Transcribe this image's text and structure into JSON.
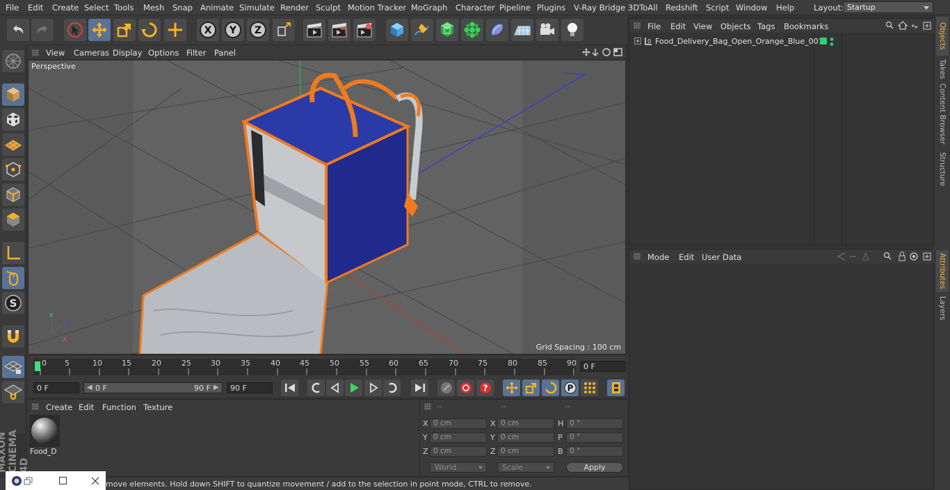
{
  "menubar": {
    "items": [
      "File",
      "Edit",
      "Create",
      "Select",
      "Tools",
      "Mesh",
      "Snap",
      "Animate",
      "Simulate",
      "Render",
      "Sculpt",
      "Motion Tracker",
      "MoGraph",
      "Character",
      "Pipeline",
      "Plugins",
      "V-Ray Bridge",
      "3DToAll",
      "Redshift",
      "Script",
      "Window",
      "Help"
    ],
    "layout_label": "Layout:",
    "layout_value": "Startup"
  },
  "viewport": {
    "menu": [
      "View",
      "Cameras",
      "Display",
      "Options",
      "Filter",
      "Panel"
    ],
    "label": "Perspective",
    "grid_spacing": "Grid Spacing : 100 cm"
  },
  "timeline": {
    "ticks": [
      "0",
      "5",
      "10",
      "15",
      "20",
      "25",
      "30",
      "35",
      "40",
      "45",
      "50",
      "55",
      "60",
      "65",
      "70",
      "75",
      "80",
      "85",
      "90"
    ],
    "current_frame": "0 F"
  },
  "playbar": {
    "start_field": "0 F",
    "range_start": "0 F",
    "range_end": "90 F",
    "end_field": "90 F"
  },
  "materials": {
    "menu": [
      "Create",
      "Edit",
      "Function",
      "Texture"
    ],
    "items": [
      {
        "label": "Food_D"
      }
    ]
  },
  "coordinates": {
    "headers": [
      "--",
      "--",
      "--"
    ],
    "rows": [
      {
        "l1": "X",
        "v1": "0 cm",
        "l2": "X",
        "v2": "0 cm",
        "l3": "H",
        "v3": "0 °"
      },
      {
        "l1": "Y",
        "v1": "0 cm",
        "l2": "Y",
        "v2": "0 cm",
        "l3": "P",
        "v3": "0 °"
      },
      {
        "l1": "Z",
        "v1": "0 cm",
        "l2": "Z",
        "v2": "0 cm",
        "l3": "B",
        "v3": "0 °"
      }
    ],
    "world": "World",
    "scale": "Scale",
    "apply": "Apply"
  },
  "objects": {
    "menu": [
      "File",
      "Edit",
      "View",
      "Objects",
      "Tags",
      "Bookmarks"
    ],
    "items": [
      {
        "name": "Food_Delivery_Bag_Open_Orange_Blue_001"
      }
    ]
  },
  "attributes": {
    "menu": [
      "Mode",
      "Edit",
      "User Data"
    ]
  },
  "right_tabs": {
    "top": [
      "Objects",
      "Takes",
      "Content Browser",
      "Structure"
    ],
    "bottom": [
      "Attributes",
      "Layers"
    ]
  },
  "brand": "MAXON CINEMA 4D",
  "status": "move elements. Hold down SHIFT to quantize movement / add to the selection in point mode, CTRL to remove.",
  "colors": {
    "accent": "#f2b54a",
    "active_tool": "#5a7394",
    "bag_blue": "#1f2a8c",
    "bag_orange": "#f07a1e"
  }
}
